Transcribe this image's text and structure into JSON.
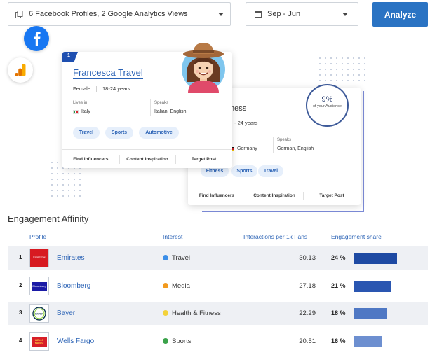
{
  "toolbar": {
    "profiles_label": "6 Facebook Profiles, 2 Google Analytics Views",
    "date_label": "Sep - Jun",
    "analyze_label": "Analyze"
  },
  "cards": {
    "front": {
      "rank": "1",
      "name": "Francesca Travel",
      "gender": "Female",
      "age": "18-24 years",
      "lives_in_label": "Lives in",
      "lives_in_value": "Italy",
      "speaks_label": "Speaks",
      "speaks_value": "Italian, English",
      "tags": [
        "Travel",
        "Sports",
        "Automotive"
      ],
      "actions": [
        "Find Influencers",
        "Content Inspiration",
        "Target Post"
      ]
    },
    "back": {
      "name_partial": "ness",
      "age_partial": "- 24 years",
      "lives_in_value": "Germany",
      "speaks_label": "Speaks",
      "speaks_value": "German, English",
      "tags": [
        "Fitness",
        "Sports",
        "Travel"
      ],
      "actions": [
        "Find Influencers",
        "Content Inspiration",
        "Target Post"
      ]
    },
    "audience": {
      "percent": "9%",
      "caption": "of your Audience"
    }
  },
  "engagement": {
    "title": "Engagement Affinity",
    "headers": {
      "profile": "Profile",
      "interest": "Interest",
      "interactions": "Interactions per 1k Fans",
      "share": "Engagement share"
    },
    "rows": [
      {
        "rank": "1",
        "name": "Emirates",
        "logo_text": "Emirates",
        "interest": "Travel",
        "interest_color": "#3b8ee8",
        "interactions": "30.13",
        "share": "24 %",
        "share_value": 24,
        "bar_color": "#1e4aa3"
      },
      {
        "rank": "2",
        "name": "Bloomberg",
        "logo_text": "Bloomberg",
        "interest": "Media",
        "interest_color": "#f29a1e",
        "interactions": "27.18",
        "share": "21 %",
        "share_value": 21,
        "bar_color": "#2a56b1"
      },
      {
        "rank": "3",
        "name": "Bayer",
        "logo_text": "BAYER",
        "interest": "Health & Fitness",
        "interest_color": "#f3d23a",
        "interactions": "22.29",
        "share": "18 %",
        "share_value": 18,
        "bar_color": "#4f78c4"
      },
      {
        "rank": "4",
        "name": "Wells Fargo",
        "logo_text": "WELLS FARGO",
        "interest": "Sports",
        "interest_color": "#3aa24a",
        "interactions": "20.51",
        "share": "16 %",
        "share_value": 16,
        "bar_color": "#6d8fd0"
      }
    ]
  }
}
